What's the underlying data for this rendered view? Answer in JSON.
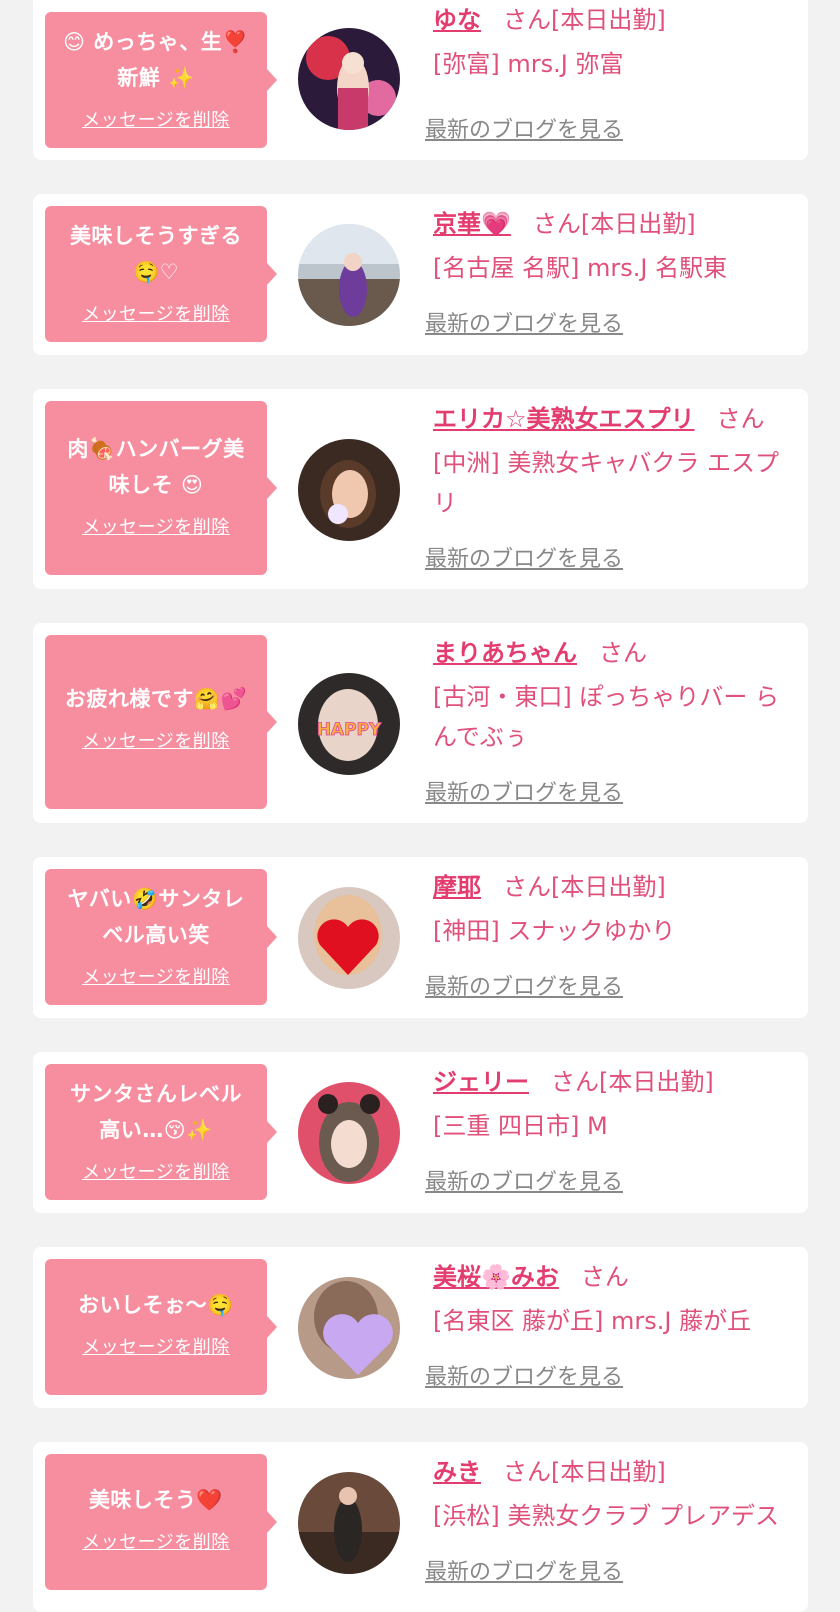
{
  "delete_label": "メッセージを削除",
  "blog_label": "最新のブログを見る",
  "colors": {
    "bubble": "#f78ea0",
    "name": "#e33c6e",
    "shop": "#e0507a",
    "link_gray": "#888888",
    "background": "#f2f2f2"
  },
  "items": [
    {
      "message": "めっちゃ、生\n新鮮",
      "message_lines": [
        "😊 めっちゃ、生❣️",
        "新鮮 ✨"
      ],
      "name": "ゆな",
      "suffix": "さん[本日出勤]",
      "shop": "[弥富] mrs.J 弥富",
      "avatar_icon": "girl-kimono-photo"
    },
    {
      "message_lines": [
        "美味しそうすぎる",
        "🤤♡"
      ],
      "name": "京華💗",
      "suffix": "さん[本日出勤]",
      "shop": "[名古屋 名駅] mrs.J 名駅東",
      "avatar_icon": "girl-purple-dress-photo"
    },
    {
      "message_lines": [
        "肉🍖ハンバーグ美",
        "味しそ 😍"
      ],
      "name": "エリカ☆美熟女エスプリ",
      "suffix": "さん",
      "shop": "[中洲] 美熟女キャバクラ エスプリ",
      "avatar_icon": "woman-selfie-photo"
    },
    {
      "message_lines": [
        "お疲れ様です🤗💕"
      ],
      "name": "まりあちゃん",
      "suffix": "さん",
      "shop": "[古河・東口] ぽっちゃりバー らんでぶぅ",
      "avatar_icon": "happy-sticker-photo"
    },
    {
      "message_lines": [
        "ヤバい🤣サンタレ",
        "ベル高い笑"
      ],
      "name": "摩耶",
      "suffix": "さん[本日出勤]",
      "shop": "[神田] スナックゆかり",
      "avatar_icon": "heart-covered-face-photo"
    },
    {
      "message_lines": [
        "サンタさんレベル",
        "高い…😚✨"
      ],
      "name": "ジェリー",
      "suffix": "さん[本日出勤]",
      "shop": "[三重 四日市] M",
      "avatar_icon": "girl-pink-background-photo"
    },
    {
      "message_lines": [
        "おいしそぉ～🤤"
      ],
      "name": "美桜🌸みお",
      "suffix": "さん",
      "shop": "[名東区 藤が丘] mrs.J 藤が丘",
      "avatar_icon": "purple-heart-face-photo"
    },
    {
      "message_lines": [
        "美味しそう❤️"
      ],
      "name": "みき",
      "suffix": "さん[本日出勤]",
      "shop": "[浜松] 美熟女クラブ プレアデス",
      "avatar_icon": "woman-lace-dress-photo"
    }
  ]
}
